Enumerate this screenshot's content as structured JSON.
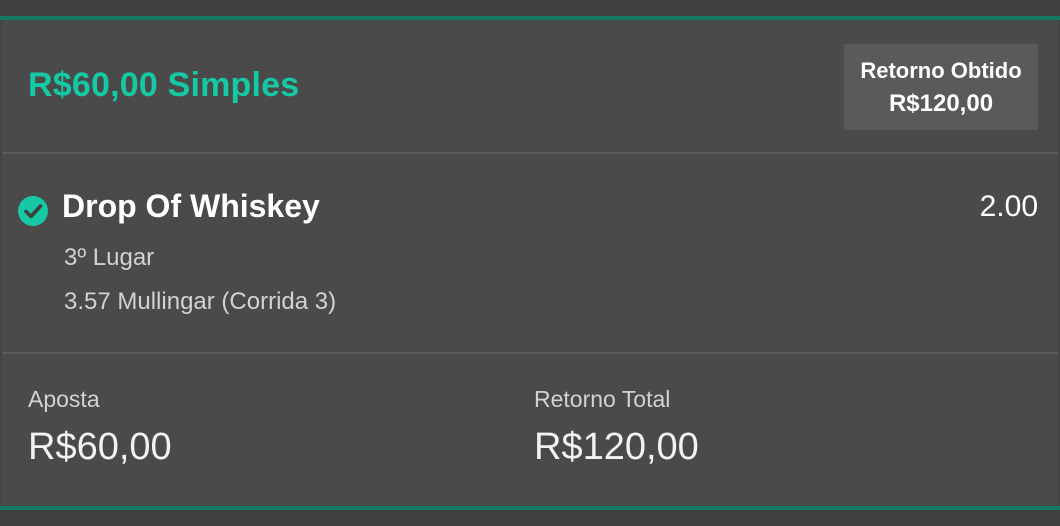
{
  "bet": {
    "title": "R$60,00 Simples",
    "returned_label": "Retorno Obtido",
    "returned_value": "R$120,00"
  },
  "selection": {
    "status_icon": "check-circle-icon",
    "name": "Drop Of Whiskey",
    "odds": "2.00",
    "market": "3º Lugar",
    "event": "3.57 Mullingar (Corrida 3)"
  },
  "summary": {
    "stake_label": "Aposta",
    "stake_value": "R$60,00",
    "total_return_label": "Retorno Total",
    "total_return_value": "R$120,00"
  },
  "colors": {
    "accent": "#14c9a3",
    "background": "#4a4a4a",
    "border_accent": "#157a63"
  }
}
